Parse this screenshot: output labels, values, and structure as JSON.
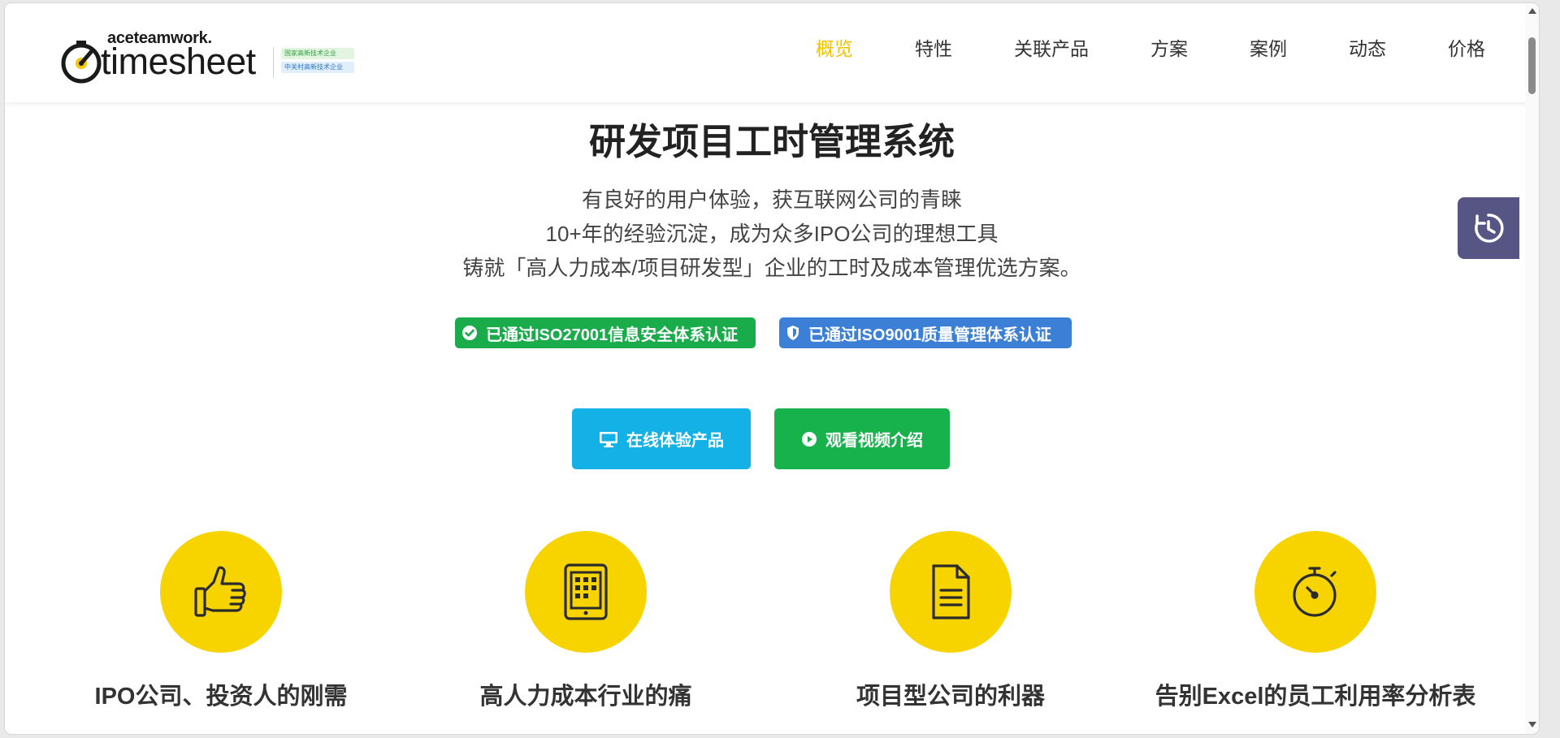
{
  "header": {
    "brand": "aceteamwork.",
    "product": "timesheet",
    "badges": [
      "国家高新技术企业",
      "中关村高新技术企业"
    ]
  },
  "nav": {
    "items": [
      "概览",
      "特性",
      "关联产品",
      "方案",
      "案例",
      "动态",
      "价格"
    ],
    "active_index": 0,
    "active_color": "#f2c200"
  },
  "hero": {
    "title": "研发项目工时管理系统",
    "lines": [
      "有良好的用户体验，获互联网公司的青睐",
      "10+年的经验沉淀，成为众多IPO公司的理想工具",
      "铸就「高人力成本/项目研发型」企业的工时及成本管理优选方案。"
    ]
  },
  "certs": [
    {
      "label": "已通过ISO27001信息安全体系认证",
      "icon": "check-circle-icon",
      "color": "#1aab4b"
    },
    {
      "label": "已通过ISO9001质量管理体系认证",
      "icon": "shield-icon",
      "color": "#3b80d6"
    }
  ],
  "cta": {
    "try_label": "在线体验产品",
    "try_icon": "monitor-icon",
    "try_color": "#13b1e6",
    "video_label": "观看视频介绍",
    "video_icon": "play-circle-icon",
    "video_color": "#18b24c"
  },
  "features": [
    {
      "label": "IPO公司、投资人的刚需",
      "icon": "thumbs-up-icon"
    },
    {
      "label": "高人力成本行业的痛",
      "icon": "tablet-icon"
    },
    {
      "label": "项目型公司的利器",
      "icon": "document-icon"
    },
    {
      "label": "告别Excel的员工利用率分析表",
      "icon": "stopwatch-icon"
    }
  ],
  "colors": {
    "feature_circle": "#f7d400",
    "float_widget": "#575583"
  }
}
